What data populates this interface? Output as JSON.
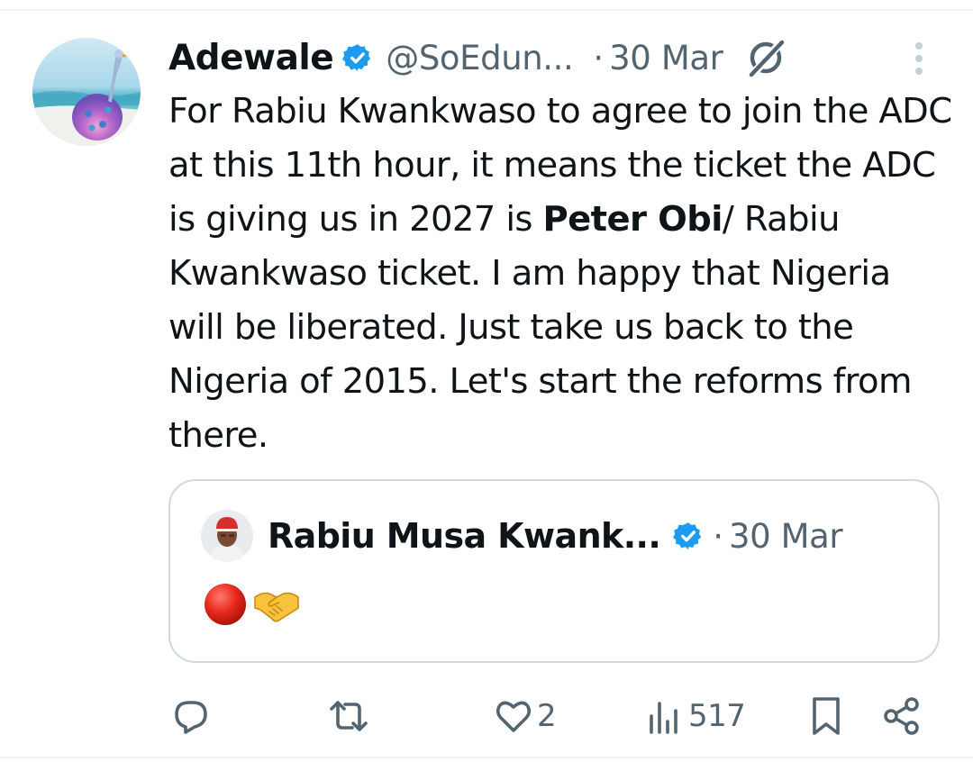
{
  "tweet": {
    "author_name": "Adewale",
    "author_handle": "@SoEdun...",
    "separator": "·",
    "date": "30 Mar",
    "text_part1": "For Rabiu Kwankwaso to agree to join the ADC at this 11th hour, it means the ticket the ADC is giving us in 2027 is ",
    "text_bold": "Peter Obi",
    "text_part2": "/ Rabiu Kwankwaso ticket. I am happy that Nigeria will be liberated. Just take us back to the Nigeria of 2015. Let's start the reforms from there."
  },
  "quoted_tweet": {
    "author_name": "Rabiu Musa Kwank...",
    "separator": "·",
    "date": "30 Mar",
    "emoji_text": "🔴🤝"
  },
  "actions": {
    "reply_count": "",
    "retweet_count": "",
    "like_count": "2",
    "views_count": "517"
  },
  "icons": {
    "verified": "verified-badge-icon",
    "grok": "grok-icon",
    "more": "more-vertical-icon",
    "reply": "reply-icon",
    "retweet": "retweet-icon",
    "like": "heart-icon",
    "views": "views-chart-icon",
    "bookmark": "bookmark-icon",
    "share": "share-icon"
  },
  "colors": {
    "text": "#0f1419",
    "secondary": "#536471",
    "verified": "#1d9bf0",
    "border": "#cfd9de"
  }
}
